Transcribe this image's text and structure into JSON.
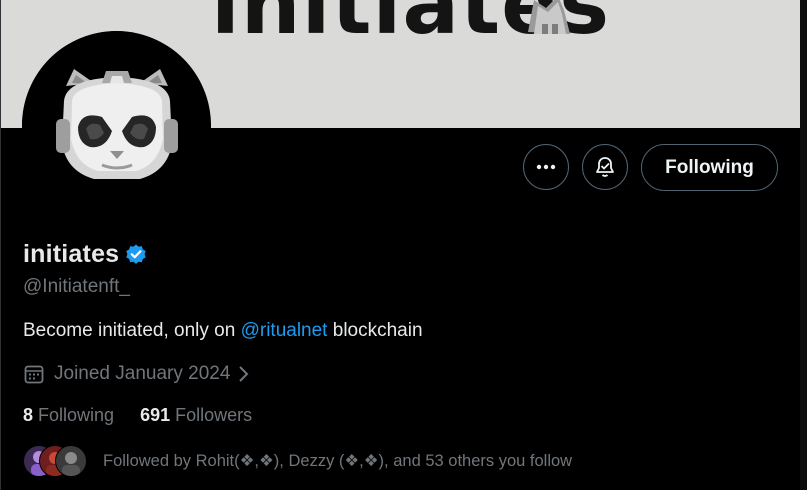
{
  "banner": {
    "title": "initiates"
  },
  "profile": {
    "display_name": "initiates",
    "handle": "@Initiatenft_",
    "bio_prefix": "Become initiated, only on ",
    "bio_mention": "@ritualnet",
    "bio_suffix": " blockchain",
    "joined": "Joined January 2024"
  },
  "actions": {
    "more_icon": "more-horizontal-icon",
    "notify_icon": "bell-check-icon",
    "follow_label": "Following"
  },
  "stats": {
    "following_count": "8",
    "following_label": "Following",
    "followers_count": "691",
    "followers_label": "Followers"
  },
  "followed_by": {
    "text": "Followed by Rohit(❖,❖), Dezzy (❖,❖), and 53 others you follow"
  },
  "colors": {
    "background": "#000000",
    "accent": "#1d9bf0",
    "muted": "#71767b",
    "banner": "#dadad8"
  }
}
